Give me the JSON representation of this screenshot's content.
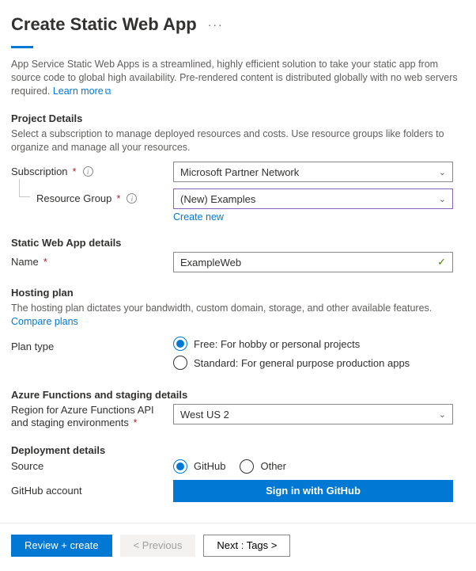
{
  "header": {
    "title": "Create Static Web App"
  },
  "intro": {
    "text": "App Service Static Web Apps is a streamlined, highly efficient solution to take your static app from source code to global high availability. Pre-rendered content is distributed globally with no web servers required.",
    "learn_more": "Learn more"
  },
  "project_details": {
    "title": "Project Details",
    "desc": "Select a subscription to manage deployed resources and costs. Use resource groups like folders to organize and manage all your resources.",
    "subscription_label": "Subscription",
    "subscription_value": "Microsoft Partner Network",
    "rg_label": "Resource Group",
    "rg_value": "(New) Examples",
    "create_new": "Create new"
  },
  "swa_details": {
    "title": "Static Web App details",
    "name_label": "Name",
    "name_value": "ExampleWeb"
  },
  "hosting": {
    "title": "Hosting plan",
    "desc_text": "The hosting plan dictates your bandwidth, custom domain, storage, and other available features.",
    "compare": "Compare plans",
    "plan_label": "Plan type",
    "free_label": "Free: For hobby or personal projects",
    "std_label": "Standard: For general purpose production apps"
  },
  "functions": {
    "title": "Azure Functions and staging details",
    "region_label": "Region for Azure Functions API and staging environments",
    "region_value": "West US 2"
  },
  "deployment": {
    "title": "Deployment details",
    "source_label": "Source",
    "github": "GitHub",
    "other": "Other",
    "gh_account_label": "GitHub account",
    "signin": "Sign in with GitHub"
  },
  "footer": {
    "review": "Review + create",
    "previous": "< Previous",
    "next": "Next : Tags >"
  }
}
